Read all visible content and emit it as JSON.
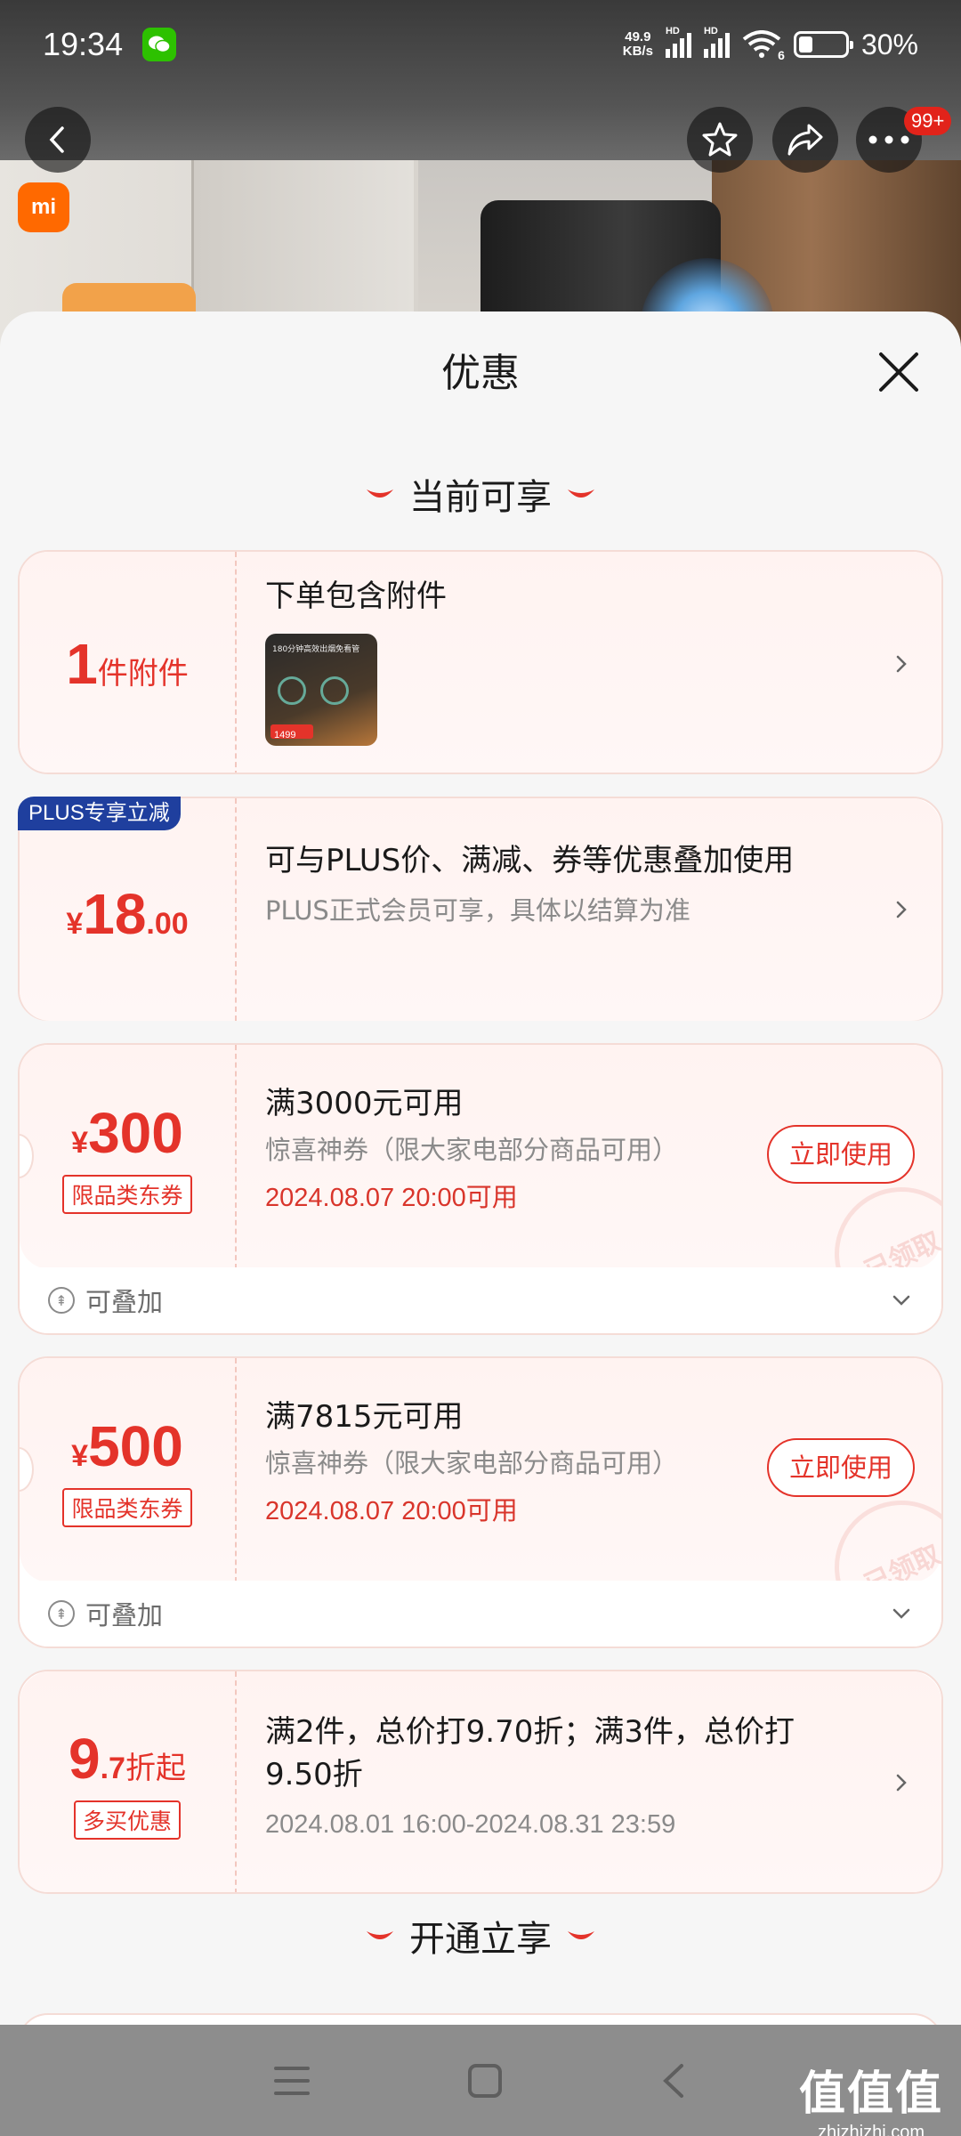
{
  "status_bar": {
    "time": "19:34",
    "net_speed_value": "49.9",
    "net_speed_unit": "KB/s",
    "hd1": "HD",
    "hd2": "HD",
    "wifi_label": "6",
    "battery": "30%",
    "battery_level": 0.3
  },
  "top_nav": {
    "back_icon": "back-arrow-icon",
    "favorite_icon": "star-icon",
    "share_icon": "share-icon",
    "more_icon": "more-dots-icon",
    "more_badge": "99+"
  },
  "background": {
    "brand_logo": "mi"
  },
  "sheet": {
    "title": "优惠",
    "close_icon": "close-icon",
    "section_current": "当前可享",
    "section_open": "开通立享"
  },
  "offers": [
    {
      "left_value": "1",
      "left_unit": "件附件",
      "title": "下单包含附件",
      "thumb_caption": "180分钟高效出烟免看管",
      "thumb_price": "1499"
    },
    {
      "tag": "PLUS专享立减",
      "yen": "¥",
      "amount_int": "18",
      "amount_dec": ".00",
      "title": "可与PLUS价、满减、券等优惠叠加使用",
      "subtitle": "PLUS正式会员可享，具体以结算为准"
    },
    {
      "yen": "¥",
      "amount": "300",
      "tag": "限品类东券",
      "title": "满3000元可用",
      "subtitle": "惊喜神券（限大家电部分商品可用）",
      "date": "2024.08.07 20:00可用",
      "button": "立即使用",
      "stamp": "已领取",
      "stack_label": "可叠加"
    },
    {
      "yen": "¥",
      "amount": "500",
      "tag": "限品类东券",
      "title": "满7815元可用",
      "subtitle": "惊喜神券（限大家电部分商品可用）",
      "date": "2024.08.07 20:00可用",
      "button": "立即使用",
      "stamp": "已领取",
      "stack_label": "可叠加"
    },
    {
      "amount_int": "9",
      "amount_dec": ".7",
      "amount_unit": "折起",
      "tag": "多买优惠",
      "title": "满2件，总价打9.70折；满3件，总价打9.50折",
      "subtitle": "2024.08.01 16:00-2024.08.31 23:59"
    }
  ],
  "nav_bar": {
    "menu_icon": "menu-icon",
    "home_icon": "home-square-icon",
    "back_icon": "back-chevron-icon"
  },
  "watermark": {
    "main": "值值值",
    "domain": "zhizhizhi.com"
  },
  "colors": {
    "accent_red": "#e4332a",
    "plus_blue": "#1f3f9e",
    "card_bg": "#fff3f1"
  }
}
